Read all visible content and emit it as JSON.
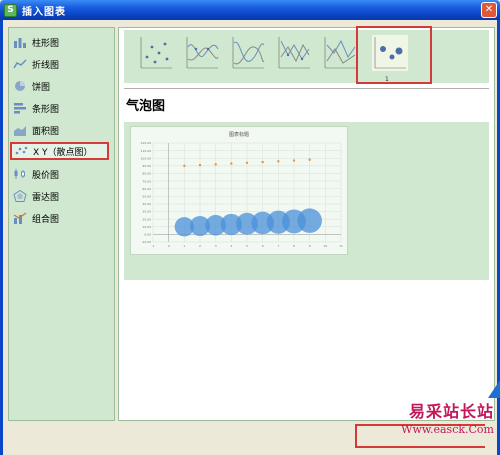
{
  "window": {
    "title": "插入图表",
    "app_icon": "S",
    "close_glyph": "✕"
  },
  "categories": [
    {
      "label": "柱形图",
      "icon": "bar-icon"
    },
    {
      "label": "折线图",
      "icon": "line-icon"
    },
    {
      "label": "饼图",
      "icon": "pie-icon"
    },
    {
      "label": "条形图",
      "icon": "hbar-icon"
    },
    {
      "label": "面积图",
      "icon": "area-icon"
    },
    {
      "label": "X Y（散点图）",
      "icon": "scatter-icon",
      "selected": true
    },
    {
      "label": "股价图",
      "icon": "stock-icon"
    },
    {
      "label": "雷达图",
      "icon": "radar-icon"
    },
    {
      "label": "组合图",
      "icon": "combo-icon"
    }
  ],
  "subtypes": [
    {
      "name": "scatter-markers"
    },
    {
      "name": "scatter-smooth-markers"
    },
    {
      "name": "scatter-smooth"
    },
    {
      "name": "scatter-straight-markers"
    },
    {
      "name": "scatter-straight"
    },
    {
      "name": "bubble",
      "selected": true,
      "sublabel": "1"
    }
  ],
  "preview": {
    "heading": "气泡图",
    "chart_title": "图表标题"
  },
  "chart_data": {
    "type": "scatter",
    "title": "图表标题",
    "series": [
      {
        "name": "",
        "type": "scatter",
        "x": [
          1,
          2,
          3,
          4,
          5,
          6,
          7,
          8,
          9
        ],
        "y": [
          90,
          91,
          92,
          93,
          94,
          95,
          96,
          97,
          98
        ],
        "color": "#f28e2b"
      },
      {
        "name": "",
        "type": "bubble",
        "x": [
          1,
          2,
          3,
          4,
          5,
          6,
          7,
          8,
          9
        ],
        "y": [
          10,
          11,
          12,
          13,
          14,
          15,
          16,
          17,
          18
        ],
        "size": [
          60,
          62,
          64,
          66,
          68,
          70,
          72,
          74,
          76
        ],
        "color": "#4a90d9"
      }
    ],
    "xlim": [
      -1,
      11
    ],
    "ylim": [
      -10,
      120
    ],
    "grid": true,
    "x_ticks": [
      "-1",
      "0",
      "1",
      "2",
      "3",
      "4",
      "5",
      "6",
      "7",
      "8",
      "9",
      "10",
      "11"
    ],
    "y_ticks": [
      "-10.00",
      "0.00",
      "10.00",
      "20.00",
      "30.00",
      "40.00",
      "50.00",
      "60.00",
      "70.00",
      "80.00",
      "90.00",
      "100.00",
      "110.00",
      "120.00"
    ]
  },
  "watermark": {
    "text": "易采站长站",
    "url": "Www.easck.Com"
  },
  "colors": {
    "selection_red": "#d43a3a",
    "panel_green": "#cfe8cf",
    "bubble_blue": "#4a90d9",
    "marker_orange": "#f28e2b"
  }
}
